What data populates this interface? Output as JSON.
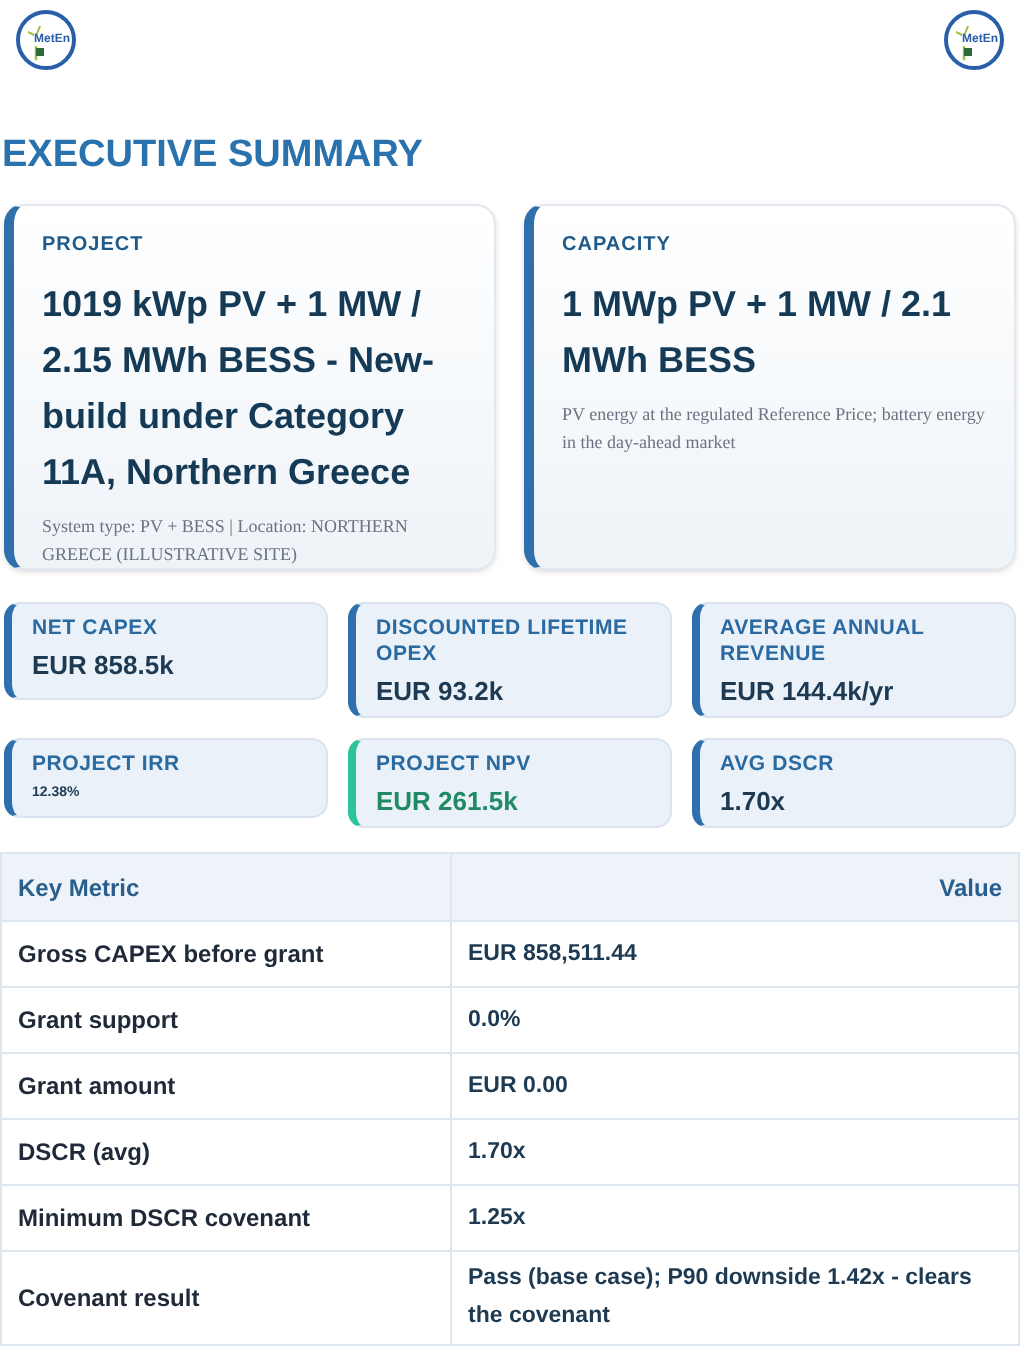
{
  "header": {
    "logos": [
      {
        "text": "MetEn"
      },
      {
        "text": "MetEn"
      }
    ]
  },
  "title": "EXECUTIVE SUMMARY",
  "hero_cards": [
    {
      "label": "PROJECT",
      "value": "1019 kWp PV + 1 MW / 2.15 MWh BESS - New-build under Category 11A, Northern Greece",
      "note": "System type: PV + BESS | Location: NORTHERN GREECE (ILLUSTRATIVE SITE)"
    },
    {
      "label": "CAPACITY",
      "value": "1 MWp PV + 1 MW / 2.1 MWh BESS",
      "note": "PV energy at the regulated Reference Price; battery energy in the day-ahead market"
    }
  ],
  "kpis": [
    {
      "label": "NET CAPEX",
      "value": "EUR 858.5k",
      "kind": "standard",
      "color": "#2f6fab",
      "compact": false
    },
    {
      "label": "DISCOUNTED LIFETIME OPEX",
      "value": "EUR 93.2k",
      "kind": "standard",
      "color": "#2f6fab",
      "compact": false
    },
    {
      "label": "AVERAGE ANNUAL REVENUE",
      "value": "EUR 144.4k/yr",
      "kind": "standard",
      "color": "#2f6fab",
      "compact": false
    },
    {
      "label": "PROJECT IRR",
      "value": "12.38%",
      "kind": "standard",
      "color": "#2f6fab",
      "compact": true
    },
    {
      "label": "PROJECT NPV",
      "value": "EUR 261.5k",
      "kind": "highlight",
      "color": "#2bc49a",
      "compact": false
    },
    {
      "label": "AVG DSCR",
      "value": "1.70x",
      "kind": "standard",
      "color": "#2f6fab",
      "compact": false
    }
  ],
  "table": {
    "columns": [
      "Key Metric",
      "Value"
    ],
    "rows": [
      [
        "Gross CAPEX before grant",
        "EUR 858,511.44"
      ],
      [
        "Grant support",
        "0.0%"
      ],
      [
        "Grant amount",
        "EUR 0.00"
      ],
      [
        "DSCR (avg)",
        "1.70x"
      ],
      [
        "Minimum DSCR covenant",
        "1.25x"
      ],
      [
        "Covenant result",
        "Pass (base case); P90 downside 1.42x - clears the covenant"
      ]
    ]
  }
}
